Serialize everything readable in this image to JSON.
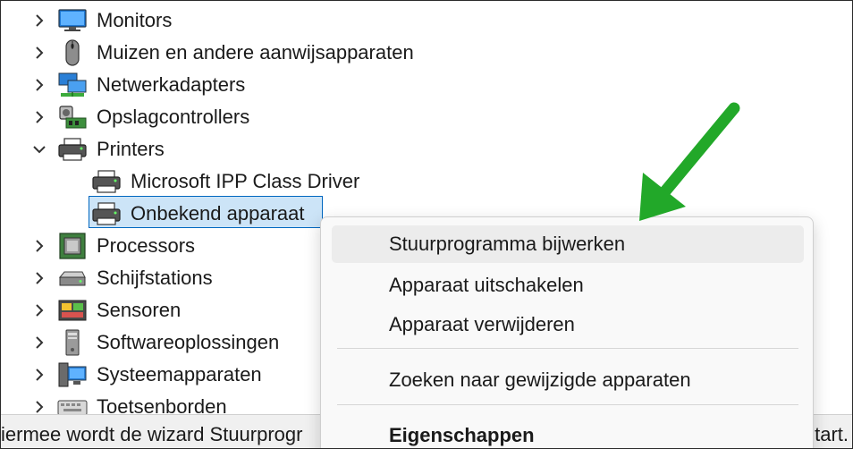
{
  "tree": {
    "categories": [
      {
        "label": "Monitors",
        "icon": "monitor-icon",
        "expanded": false
      },
      {
        "label": "Muizen en andere aanwijsapparaten",
        "icon": "mouse-icon",
        "expanded": false
      },
      {
        "label": "Netwerkadapters",
        "icon": "network-adapter-icon",
        "expanded": false
      },
      {
        "label": "Opslagcontrollers",
        "icon": "storage-controller-icon",
        "expanded": false
      },
      {
        "label": "Printers",
        "icon": "printer-icon",
        "expanded": true
      },
      {
        "label": "Processors",
        "icon": "processor-icon",
        "expanded": false
      },
      {
        "label": "Schijfstations",
        "icon": "disk-drive-icon",
        "expanded": false
      },
      {
        "label": "Sensoren",
        "icon": "sensor-icon",
        "expanded": false
      },
      {
        "label": "Softwareoplossingen",
        "icon": "software-component-icon",
        "expanded": false
      },
      {
        "label": "Systeemapparaten",
        "icon": "system-devices-icon",
        "expanded": false
      },
      {
        "label": "Toetsenborden",
        "icon": "keyboard-icon",
        "expanded": false
      }
    ],
    "printer_children": [
      {
        "label": "Microsoft IPP Class Driver",
        "icon": "printer-icon"
      },
      {
        "label": "Onbekend apparaat",
        "icon": "printer-icon",
        "selected": true
      }
    ]
  },
  "context_menu": {
    "items": [
      {
        "label": "Stuurprogramma bijwerken"
      },
      {
        "label": "Apparaat uitschakelen"
      },
      {
        "label": "Apparaat verwijderen"
      },
      {
        "label": "Zoeken naar gewijzigde apparaten"
      },
      {
        "label": "Eigenschappen"
      }
    ]
  },
  "statusbar": {
    "left_text": "iermee wordt de wizard Stuurprogr",
    "right_text": "tart."
  },
  "colors": {
    "selection_bg": "#cce4f7",
    "selection_border": "#0067c0",
    "annotation_arrow": "#22a829",
    "menu_bg": "#f9f9f9"
  }
}
